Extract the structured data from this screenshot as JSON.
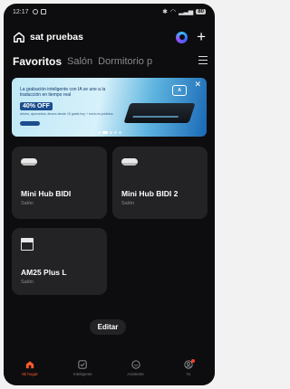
{
  "status_bar": {
    "time": "12:17",
    "battery": "80"
  },
  "header": {
    "title": "sat pruebas"
  },
  "tabs": [
    {
      "label": "Favoritos",
      "active": true
    },
    {
      "label": "Salón",
      "active": false
    },
    {
      "label": "Dormitorio p",
      "active": false
    }
  ],
  "banner": {
    "headline": "La grabación inteligente con IA se une a la traducción en tiempo real",
    "discount": "40% OFF",
    "small_text": "ahorro, aprovecha, ahorra desde 10 gratis hoy + envío en pedidos",
    "page_count": 5,
    "active_index": 1
  },
  "devices": [
    {
      "name": "Mini Hub BIDI",
      "room": "Salón",
      "icon": "hub-icon"
    },
    {
      "name": "Mini Hub BIDI 2",
      "room": "Salón",
      "icon": "hub-icon"
    },
    {
      "name": "AM25 Plus L",
      "room": "Salón",
      "icon": "curtain-icon"
    }
  ],
  "edit_button": {
    "label": "Editar"
  },
  "bottom_nav": [
    {
      "label": "Mi hogar",
      "icon": "home-icon",
      "active": true
    },
    {
      "label": "Inteligente",
      "icon": "check-square-icon",
      "active": false
    },
    {
      "label": "Asistente",
      "icon": "assistant-icon",
      "active": false
    },
    {
      "label": "Yo",
      "icon": "profile-icon",
      "active": false
    }
  ],
  "colors": {
    "accent": "#ff5a2c",
    "card": "#232325",
    "background": "#0d0d0f"
  }
}
